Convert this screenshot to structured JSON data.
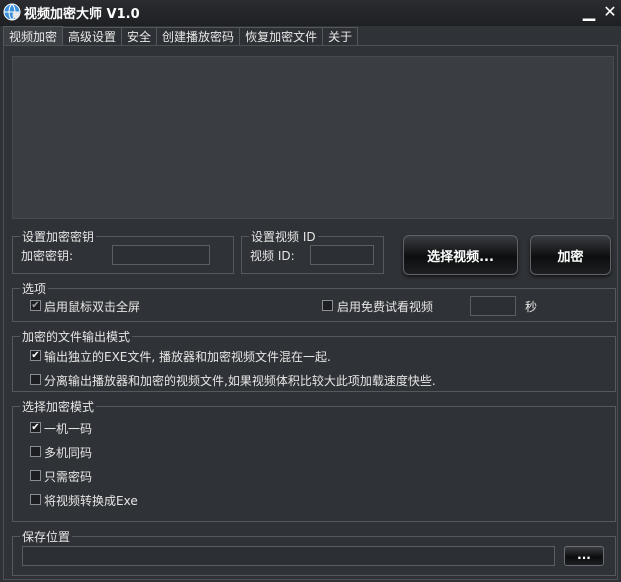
{
  "window": {
    "title": "视频加密大师 V1.0",
    "minimize_glyph": "▁",
    "close_glyph": "✕"
  },
  "tabs": [
    {
      "label": "视频加密",
      "active": true
    },
    {
      "label": "高级设置"
    },
    {
      "label": "安全"
    },
    {
      "label": "创建播放密码"
    },
    {
      "label": "恢复加密文件"
    },
    {
      "label": "关于"
    }
  ],
  "key_group": {
    "legend": "设置加密密钥",
    "label": "加密密钥:",
    "value": ""
  },
  "video_id_group": {
    "legend": "设置视频 ID",
    "label": "视频 ID:",
    "value": ""
  },
  "buttons": {
    "select_video": "选择视频...",
    "encrypt": "加密",
    "browse": "..."
  },
  "options": {
    "legend": "选项",
    "fullscreen_label": "启用鼠标双击全屏",
    "fullscreen_checked": true,
    "trial_label": "启用免费试看视频",
    "trial_checked": false,
    "trial_seconds": "",
    "seconds_unit": "秒"
  },
  "output_mode": {
    "legend": "加密的文件输出模式",
    "items": [
      {
        "label": "输出独立的EXE文件, 播放器和加密视频文件混在一起.",
        "checked": true
      },
      {
        "label": "分离输出播放器和加密的视频文件,如果视频体积比较大此项加载速度快些.",
        "checked": false
      }
    ]
  },
  "encrypt_mode": {
    "legend": "选择加密模式",
    "items": [
      {
        "label": "一机一码",
        "checked": true
      },
      {
        "label": "多机同码",
        "checked": false
      },
      {
        "label": "只需密码",
        "checked": false
      },
      {
        "label": "将视频转换成Exe",
        "checked": false
      }
    ]
  },
  "save_location": {
    "legend": "保存位置",
    "path": ""
  },
  "icons": {
    "app": "shield-globe-icon",
    "check": "✔"
  },
  "colors": {
    "background": "#2f3236",
    "titlebar": "#1e2023",
    "accent_icon": "#3a8fd8"
  }
}
